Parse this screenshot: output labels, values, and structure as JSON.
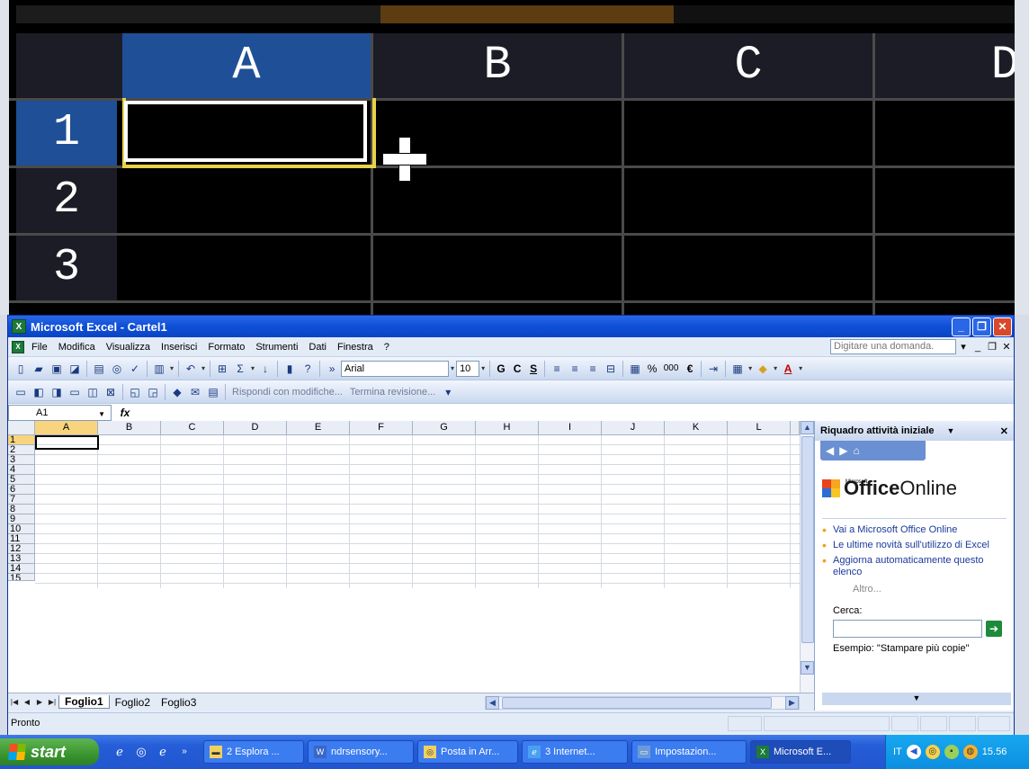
{
  "zoom": {
    "columns": [
      "A",
      "B",
      "C",
      "D"
    ],
    "rows": [
      "1",
      "2",
      "3"
    ]
  },
  "window": {
    "title": "Microsoft Excel - Cartel1",
    "minimize": "_",
    "maximize": "❐",
    "close": "✕"
  },
  "menu": {
    "items": [
      "File",
      "Modifica",
      "Visualizza",
      "Inserisci",
      "Formato",
      "Strumenti",
      "Dati",
      "Finestra",
      "?"
    ],
    "ask_placeholder": "Digitare una domanda."
  },
  "toolbar": {
    "font_name": "Arial",
    "font_size": "10",
    "bold": "G",
    "italic": "C",
    "underline": "S",
    "percent": "%",
    "thousands": "000",
    "euro": "€"
  },
  "review_toolbar": {
    "reply": "Rispondi con modifiche...",
    "end_review": "Termina revisione..."
  },
  "formula_bar": {
    "name_box": "A1",
    "fx": "fx"
  },
  "sheet": {
    "columns": [
      "A",
      "B",
      "C",
      "D",
      "E",
      "F",
      "G",
      "H",
      "I",
      "J",
      "K",
      "L"
    ],
    "rows": [
      "1",
      "2",
      "3",
      "4",
      "5",
      "6",
      "7",
      "8",
      "9",
      "10",
      "11",
      "12",
      "13",
      "14",
      "15"
    ],
    "tabs": [
      "Foglio1",
      "Foglio2",
      "Foglio3"
    ],
    "active_tab": "Foglio1"
  },
  "status": {
    "text": "Pronto"
  },
  "task_pane": {
    "title": "Riquadro attività iniziale",
    "logo_small": "Microsoft",
    "logo_office": "Office",
    "logo_online": "Online",
    "links": [
      "Vai a Microsoft Office Online",
      "Le ultime novità sull'utilizzo di Excel",
      "Aggiorna automaticamente questo elenco"
    ],
    "more": "Altro...",
    "search_label": "Cerca:",
    "example": "Esempio: \"Stampare più copie\""
  },
  "taskbar": {
    "start": "start",
    "tasks": [
      {
        "label": "2 Esplora ...",
        "icon": "folder-icon"
      },
      {
        "label": "ndrsensory...",
        "icon": "word-icon"
      },
      {
        "label": "Posta in Arr...",
        "icon": "outlook-icon"
      },
      {
        "label": "3 Internet...",
        "icon": "ie-icon"
      },
      {
        "label": "Impostazion...",
        "icon": "settings-icon"
      },
      {
        "label": "Microsoft E...",
        "icon": "excel-icon"
      }
    ],
    "lang": "IT",
    "clock": "15.56"
  }
}
